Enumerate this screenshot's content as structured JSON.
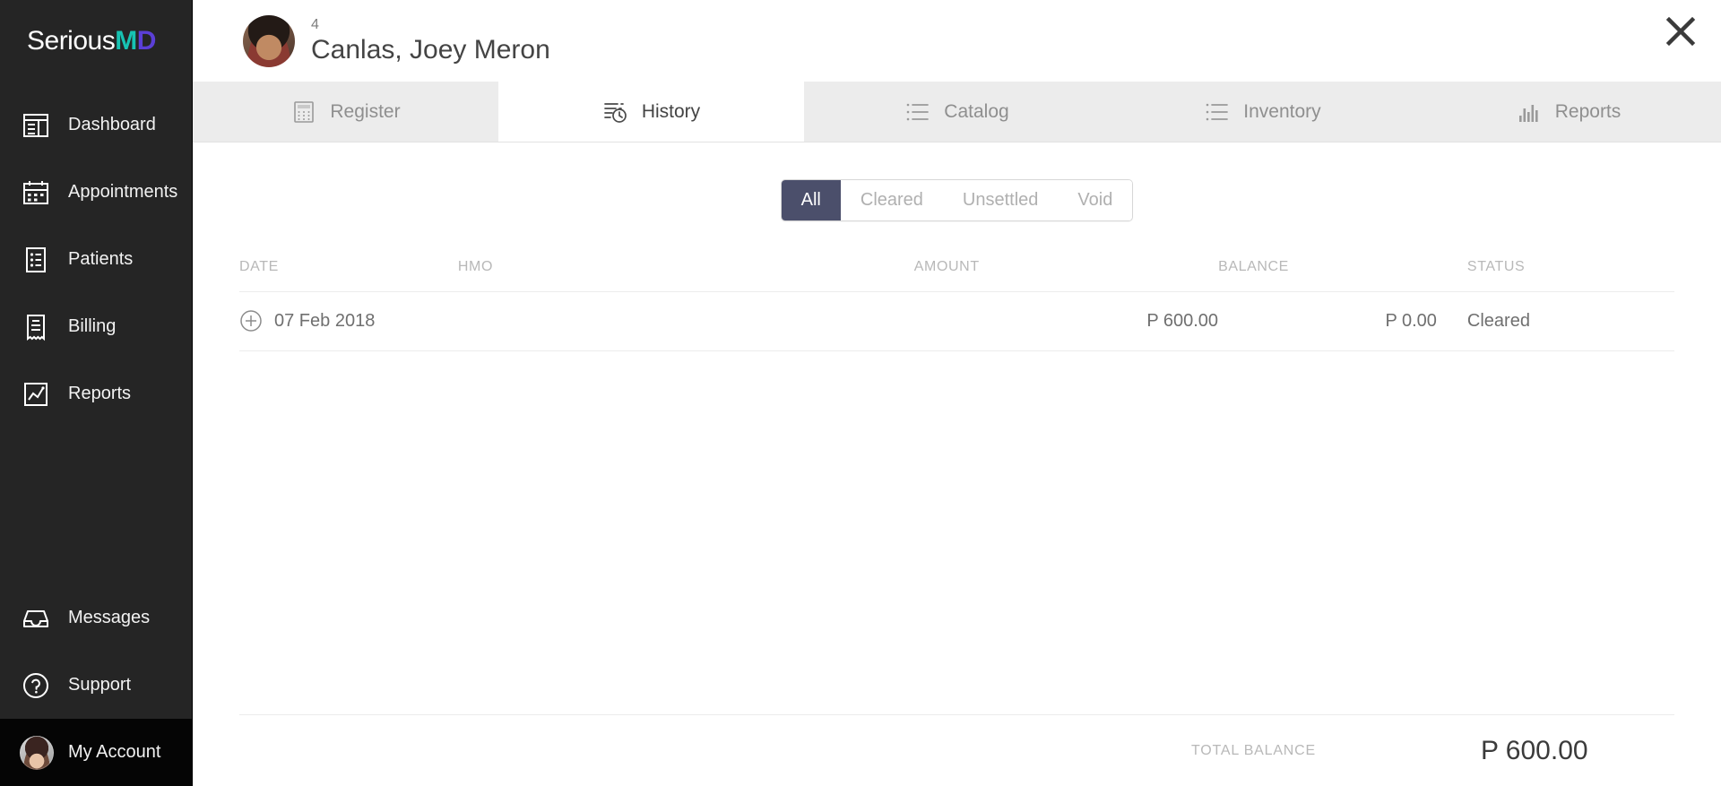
{
  "brand": {
    "name_part1": "Serious",
    "name_part2": "M",
    "name_part3": "D",
    "color_teal": "#17c3b2",
    "color_purple": "#5b3fd6"
  },
  "sidebar": {
    "items": [
      {
        "label": "Dashboard",
        "icon": "dashboard-icon"
      },
      {
        "label": "Appointments",
        "icon": "calendar-icon"
      },
      {
        "label": "Patients",
        "icon": "patient-list-icon"
      },
      {
        "label": "Billing",
        "icon": "receipt-icon"
      },
      {
        "label": "Reports",
        "icon": "chart-report-icon"
      }
    ],
    "bottom_items": [
      {
        "label": "Messages",
        "icon": "inbox-icon"
      },
      {
        "label": "Support",
        "icon": "question-circle-icon"
      }
    ],
    "account": {
      "label": "My Account",
      "icon": "avatar"
    }
  },
  "header": {
    "patient_id": "4",
    "patient_name": "Canlas, Joey Meron",
    "close_label": "×"
  },
  "tabs": [
    {
      "label": "Register",
      "icon": "calculator-icon",
      "active": false
    },
    {
      "label": "History",
      "icon": "history-clock-icon",
      "active": true
    },
    {
      "label": "Catalog",
      "icon": "list-icon",
      "active": false
    },
    {
      "label": "Inventory",
      "icon": "list-icon",
      "active": false
    },
    {
      "label": "Reports",
      "icon": "bar-chart-icon",
      "active": false
    }
  ],
  "filters": {
    "options": [
      {
        "label": "All",
        "active": true
      },
      {
        "label": "Cleared",
        "active": false
      },
      {
        "label": "Unsettled",
        "active": false
      },
      {
        "label": "Void",
        "active": false
      }
    ],
    "active_color": "#4b4f6b"
  },
  "table": {
    "columns": [
      "DATE",
      "HMO",
      "AMOUNT",
      "BALANCE",
      "STATUS"
    ],
    "rows": [
      {
        "date": "07 Feb 2018",
        "hmo": "",
        "amount": "P 600.00",
        "balance": "P 0.00",
        "status": "Cleared",
        "expand_icon": "plus-circle-icon"
      }
    ]
  },
  "footer": {
    "total_label": "TOTAL BALANCE",
    "total_value": "P 600.00"
  }
}
